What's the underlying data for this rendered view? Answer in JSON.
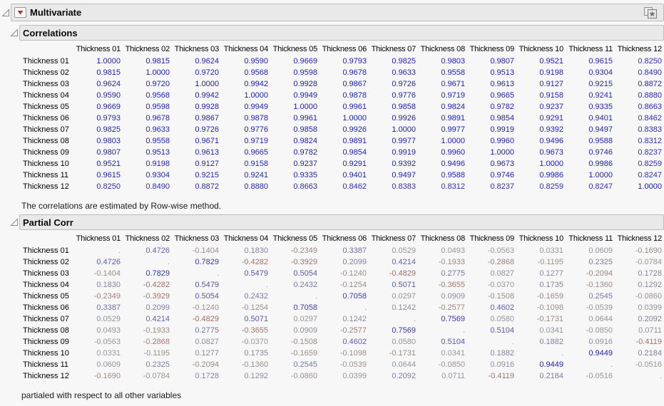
{
  "window": {
    "title": "Multivariate"
  },
  "variables": [
    "Thickness 01",
    "Thickness 02",
    "Thickness 03",
    "Thickness 04",
    "Thickness 05",
    "Thickness 06",
    "Thickness 07",
    "Thickness 08",
    "Thickness 09",
    "Thickness 10",
    "Thickness 11",
    "Thickness 12"
  ],
  "correlations": {
    "title": "Correlations",
    "note": "The correlations are estimated by Row-wise method.",
    "matrix": [
      [
        1.0,
        0.9815,
        0.9624,
        0.959,
        0.9669,
        0.9793,
        0.9825,
        0.9803,
        0.9807,
        0.9521,
        0.9615,
        0.825
      ],
      [
        0.9815,
        1.0,
        0.972,
        0.9568,
        0.9598,
        0.9678,
        0.9633,
        0.9558,
        0.9513,
        0.9198,
        0.9304,
        0.849
      ],
      [
        0.9624,
        0.972,
        1.0,
        0.9942,
        0.9928,
        0.9867,
        0.9726,
        0.9671,
        0.9613,
        0.9127,
        0.9215,
        0.8872
      ],
      [
        0.959,
        0.9568,
        0.9942,
        1.0,
        0.9949,
        0.9878,
        0.9776,
        0.9719,
        0.9665,
        0.9158,
        0.9241,
        0.888
      ],
      [
        0.9669,
        0.9598,
        0.9928,
        0.9949,
        1.0,
        0.9961,
        0.9858,
        0.9824,
        0.9782,
        0.9237,
        0.9335,
        0.8663
      ],
      [
        0.9793,
        0.9678,
        0.9867,
        0.9878,
        0.9961,
        1.0,
        0.9926,
        0.9891,
        0.9854,
        0.9291,
        0.9401,
        0.8462
      ],
      [
        0.9825,
        0.9633,
        0.9726,
        0.9776,
        0.9858,
        0.9926,
        1.0,
        0.9977,
        0.9919,
        0.9392,
        0.9497,
        0.8383
      ],
      [
        0.9803,
        0.9558,
        0.9671,
        0.9719,
        0.9824,
        0.9891,
        0.9977,
        1.0,
        0.996,
        0.9496,
        0.9588,
        0.8312
      ],
      [
        0.9807,
        0.9513,
        0.9613,
        0.9665,
        0.9782,
        0.9854,
        0.9919,
        0.996,
        1.0,
        0.9673,
        0.9746,
        0.8237
      ],
      [
        0.9521,
        0.9198,
        0.9127,
        0.9158,
        0.9237,
        0.9291,
        0.9392,
        0.9496,
        0.9673,
        1.0,
        0.9986,
        0.8259
      ],
      [
        0.9615,
        0.9304,
        0.9215,
        0.9241,
        0.9335,
        0.9401,
        0.9497,
        0.9588,
        0.9746,
        0.9986,
        1.0,
        0.8247
      ],
      [
        0.825,
        0.849,
        0.8872,
        0.888,
        0.8663,
        0.8462,
        0.8383,
        0.8312,
        0.8237,
        0.8259,
        0.8247,
        1.0
      ]
    ]
  },
  "partial": {
    "title": "Partial Corr",
    "note": "partialed with respect to all other variables",
    "missing_marker": ".",
    "matrix": [
      [
        null,
        0.4726,
        -0.1404,
        0.183,
        -0.2349,
        0.3387,
        0.0529,
        0.0493,
        -0.0563,
        0.0331,
        0.0609,
        -0.169
      ],
      [
        0.4726,
        null,
        0.7829,
        -0.4282,
        -0.3929,
        0.2099,
        0.4214,
        -0.1933,
        -0.2868,
        -0.1195,
        0.2325,
        -0.0784
      ],
      [
        -0.1404,
        0.7829,
        null,
        0.5479,
        0.5054,
        -0.124,
        -0.4829,
        0.2775,
        0.0827,
        0.1277,
        -0.2094,
        0.1728
      ],
      [
        0.183,
        -0.4282,
        0.5479,
        null,
        0.2432,
        -0.1254,
        0.5071,
        -0.3655,
        -0.037,
        0.1735,
        -0.136,
        0.1292
      ],
      [
        -0.2349,
        -0.3929,
        0.5054,
        0.2432,
        null,
        0.7058,
        0.0297,
        0.0909,
        -0.1508,
        -0.1659,
        0.2545,
        -0.086
      ],
      [
        0.3387,
        0.2099,
        -0.124,
        -0.1254,
        0.7058,
        null,
        0.1242,
        -0.2577,
        0.4602,
        -0.1098,
        -0.0539,
        0.0399
      ],
      [
        0.0529,
        0.4214,
        -0.4829,
        0.5071,
        0.0297,
        0.1242,
        null,
        0.7569,
        0.058,
        -0.1731,
        0.0644,
        0.2092
      ],
      [
        0.0493,
        -0.1933,
        0.2775,
        -0.3655,
        0.0909,
        -0.2577,
        0.7569,
        null,
        0.5104,
        0.0341,
        -0.085,
        0.0711
      ],
      [
        -0.0563,
        -0.2868,
        0.0827,
        -0.037,
        -0.1508,
        0.4602,
        0.058,
        0.5104,
        null,
        0.1882,
        0.0916,
        -0.4119
      ],
      [
        0.0331,
        -0.1195,
        0.1277,
        0.1735,
        -0.1659,
        -0.1098,
        -0.1731,
        0.0341,
        0.1882,
        null,
        0.9449,
        0.2184
      ],
      [
        0.0609,
        0.2325,
        -0.2094,
        -0.136,
        0.2545,
        -0.0539,
        0.0644,
        -0.085,
        0.0916,
        0.9449,
        null,
        -0.0516
      ],
      [
        -0.169,
        -0.0784,
        0.1728,
        0.1292,
        -0.086,
        0.0399,
        0.2092,
        0.0711,
        -0.4119,
        0.2184,
        -0.0516,
        null
      ]
    ]
  },
  "colors": {
    "positive_full": "#1a1abc",
    "negative_full": "#aa3c30",
    "neutral_gray": "#9a9a9a",
    "red_triangle": "#c42b1c"
  }
}
